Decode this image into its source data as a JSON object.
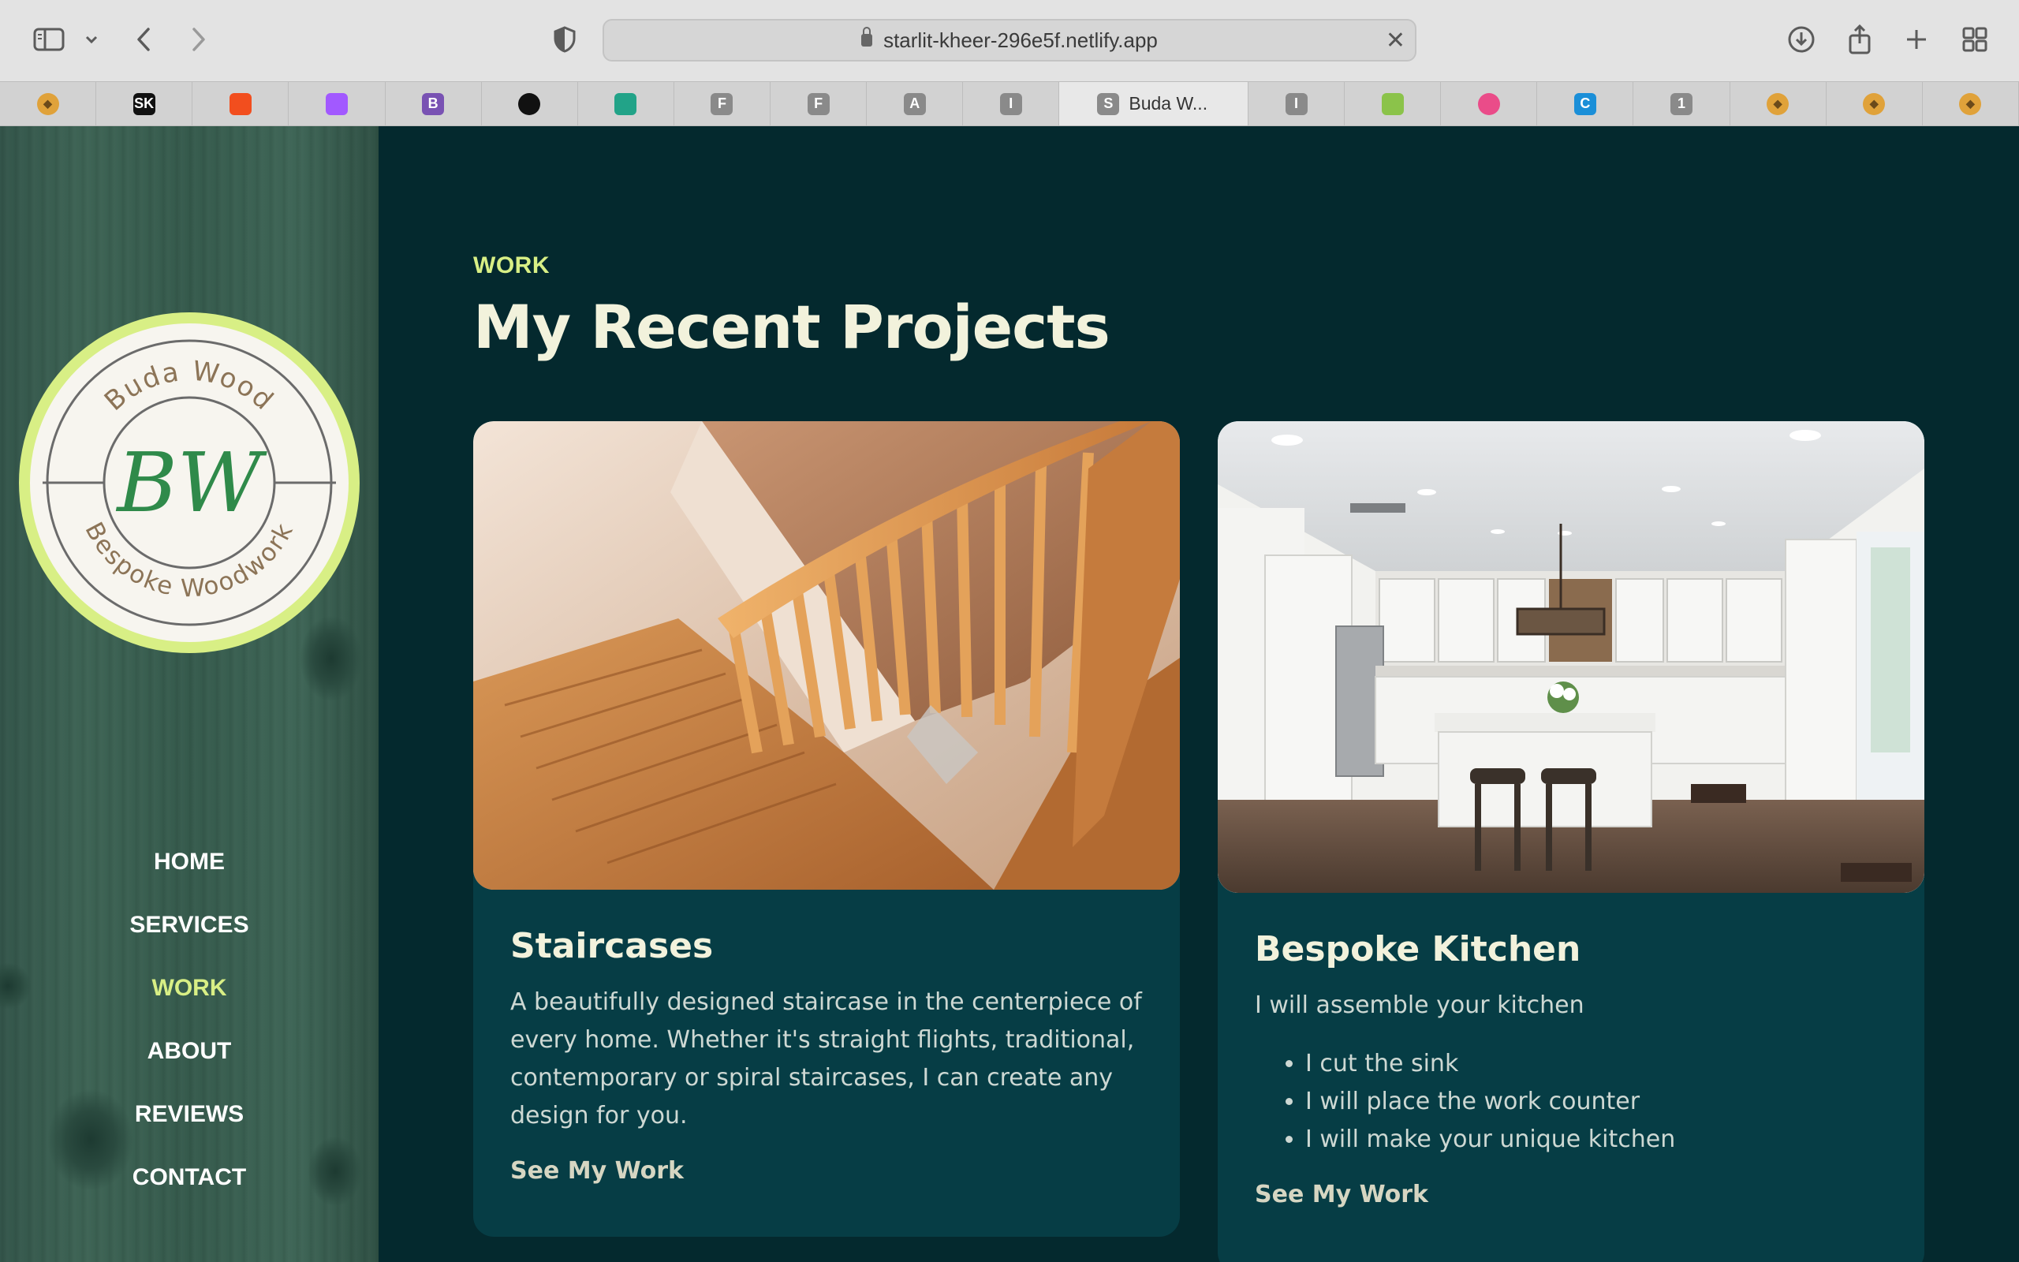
{
  "browser": {
    "url": "starlit-kheer-296e5f.netlify.app",
    "active_tab_title": "Buda W...",
    "tabs": [
      {
        "icon": "avatar-icon",
        "letter": "",
        "color": "#e0a23a"
      },
      {
        "icon": "sketch-icon",
        "letter": "SK",
        "color": "#111111"
      },
      {
        "icon": "figma-icon",
        "letter": "",
        "color": "#f24e1e"
      },
      {
        "icon": "figma-icon",
        "letter": "",
        "color": "#a259ff"
      },
      {
        "icon": "bootstrap-icon",
        "letter": "B",
        "color": "#7952b3"
      },
      {
        "icon": "github-icon",
        "letter": "",
        "color": "#111111"
      },
      {
        "icon": "diamond-icon",
        "letter": "",
        "color": "#22a388"
      },
      {
        "icon": "letter-f-icon",
        "letter": "F",
        "color": "#8a8a8a"
      },
      {
        "icon": "letter-f-icon",
        "letter": "F",
        "color": "#8a8a8a"
      },
      {
        "icon": "letter-a-icon",
        "letter": "A",
        "color": "#8a8a8a"
      },
      {
        "icon": "letter-i-icon",
        "letter": "I",
        "color": "#8a8a8a"
      },
      {
        "icon": "letter-s-icon",
        "letter": "S",
        "color": "#8a8a8a",
        "active": true
      },
      {
        "icon": "letter-i-icon",
        "letter": "I",
        "color": "#8a8a8a"
      },
      {
        "icon": "grid-app-icon",
        "letter": "",
        "color": "#8bc34a"
      },
      {
        "icon": "dribbble-icon",
        "letter": "",
        "color": "#ea4c89"
      },
      {
        "icon": "canva-icon",
        "letter": "C",
        "color": "#1b8fd8"
      },
      {
        "icon": "number-one-icon",
        "letter": "1",
        "color": "#8a8a8a"
      },
      {
        "icon": "avatar-icon",
        "letter": "",
        "color": "#e0a23a"
      },
      {
        "icon": "avatar-icon",
        "letter": "",
        "color": "#e0a23a"
      },
      {
        "icon": "avatar-icon",
        "letter": "",
        "color": "#e0a23a"
      }
    ]
  },
  "logo": {
    "top_text": "Buda Wood",
    "monogram": "BW",
    "bottom_text": "Bespoke Woodwork"
  },
  "nav": {
    "items": [
      "HOME",
      "SERVICES",
      "WORK",
      "ABOUT",
      "REVIEWS",
      "CONTACT"
    ],
    "active": "WORK"
  },
  "section": {
    "eyebrow": "WORK",
    "title": "My Recent Projects"
  },
  "projects": [
    {
      "title": "Staircases",
      "description": "A beautifully designed staircase in the centerpiece of every home. Whether it's straight flights, traditional, contemporary or spiral staircases, I can create any design for you.",
      "link": "See My Work"
    },
    {
      "title": "Bespoke Kitchen",
      "description": "I will assemble your kitchen",
      "list": [
        "I cut the sink",
        "I will place the work counter",
        "I will make your unique kitchen"
      ],
      "link": "See My Work"
    }
  ],
  "colors": {
    "accent": "#d8ef85",
    "page_bg": "#04292e",
    "card_bg": "#063d45",
    "title": "#f2f2dc"
  }
}
